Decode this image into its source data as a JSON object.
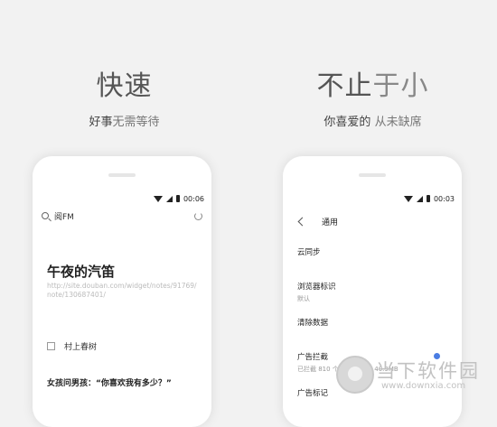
{
  "left": {
    "headline": "快速",
    "subline_a": "好事",
    "subline_b": "无需等待",
    "status_time": "00:06",
    "search_text": "阅FM",
    "article_title": "午夜的汽笛",
    "article_url": "http://site.douban.com/widget/notes/91769/note/130687401/",
    "checkbox_label": "村上春树",
    "quote": "女孩问男孩：“你喜欢我有多少？”"
  },
  "right": {
    "headline_a": "不止",
    "headline_b": "于小",
    "subline_a": "你喜爱的",
    "subline_b": "从未缺席",
    "status_time": "00:03",
    "nav_title": "通用",
    "settings": [
      {
        "label": "云同步",
        "sub": ""
      },
      {
        "label": "浏览器标识",
        "sub": "默认"
      },
      {
        "label": "清除数据",
        "sub": ""
      },
      {
        "label": "广告拦截",
        "sub": "已拦截 810 个广告 共节省 40.9MB"
      },
      {
        "label": "广告标记",
        "sub": ""
      }
    ],
    "accent_color": "#4a7de3"
  },
  "watermark": {
    "name": "当下软件园",
    "url": "www.downxia.com"
  }
}
